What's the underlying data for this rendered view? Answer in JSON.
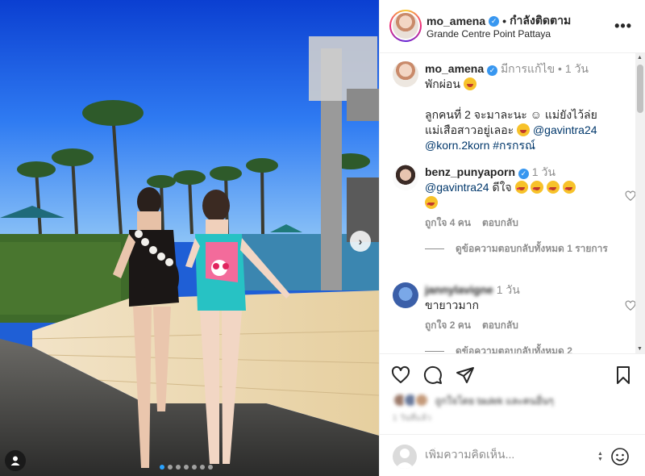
{
  "header": {
    "username": "mo_amena",
    "separator": "•",
    "follow_label": "กำลังติดตาม",
    "location": "Grande Centre Point Pattaya",
    "more_icon": "more-horizontal-icon"
  },
  "caption": {
    "username": "mo_amena",
    "edited": "มีการแก้ไข",
    "dot": "•",
    "time": "1 วัน",
    "line1": "พักผ่อน",
    "line2": "ลูกคนที่ 2 จะมาละนะ ☺ แม่ยังไว้ล่ย",
    "line3": "แม่เสือสาวอยู่เลอะ",
    "mention1": "@gavintra24",
    "mention2": "@korn.2korn",
    "hashtag": "#กรกรณ์"
  },
  "comments": [
    {
      "username": "benz_punyaporn",
      "time": "1 วัน",
      "mention": "@gavintra24",
      "text": "ดีใจ",
      "likes": "ถูกใจ 4 คน",
      "reply": "ตอบกลับ",
      "view_replies": "ดูข้อความตอบกลับทั้งหมด 1 รายการ"
    },
    {
      "username": "jannylavigne",
      "time": "1 วัน",
      "text": "ขายาวมาก",
      "likes": "ถูกใจ 2 คน",
      "reply": "ตอบกลับ",
      "view_replies": "ดูข้อความตอบกลับทั้งหมด 2"
    }
  ],
  "actions": {
    "like_icon": "heart-icon",
    "comment_icon": "comment-icon",
    "share_icon": "send-icon",
    "save_icon": "bookmark-icon",
    "likes_text": "ถูกใจโดย taulek และคนอื่นๆ",
    "date": "1 วันที่แล้ว"
  },
  "add_comment": {
    "placeholder": "เพิ่มความคิดเห็น..."
  },
  "carousel": {
    "slide_count": 7,
    "active_index": 0
  }
}
